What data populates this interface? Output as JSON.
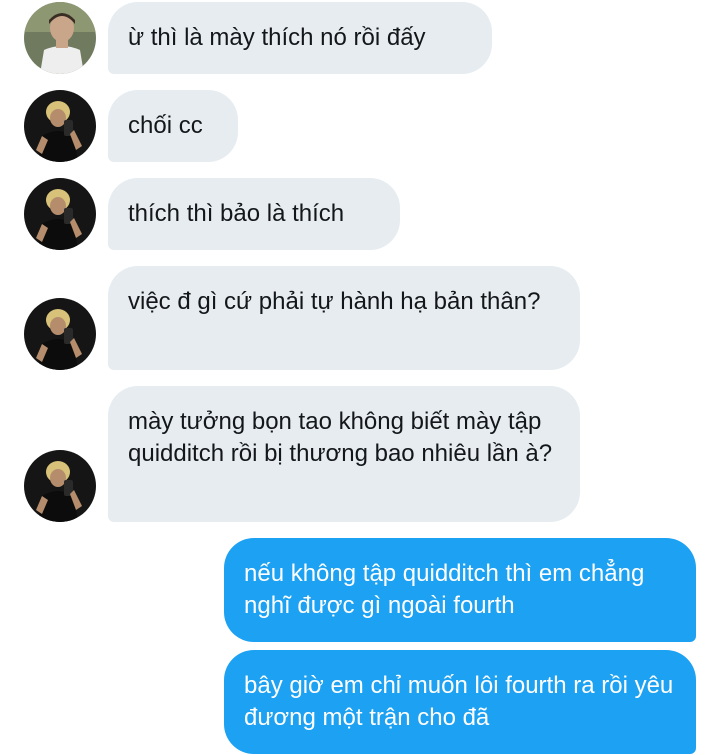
{
  "conversation": {
    "messages": [
      {
        "sender": "other_a",
        "text": "ừ thì là mày thích nó rồi đấy"
      },
      {
        "sender": "other_b",
        "text": "chối cc"
      },
      {
        "sender": "other_b",
        "text": "thích thì bảo là thích"
      },
      {
        "sender": "other_b",
        "text": "việc đ gì cứ phải tự hành hạ bản thân?"
      },
      {
        "sender": "other_b",
        "text": "mày tưởng bọn tao không biết mày tập quidditch rồi bị thương bao nhiêu lần à?"
      },
      {
        "sender": "me",
        "text": "nếu không tập quidditch thì em chẳng nghĩ được gì ngoài fourth"
      },
      {
        "sender": "me",
        "text": "bây giờ em chỉ muốn lôi fourth ra rồi yêu đương một trận cho đã"
      }
    ]
  },
  "colors": {
    "incoming_bubble": "#e6ecf0",
    "incoming_text": "#14171a",
    "outgoing_bubble": "#1da1f2",
    "outgoing_text": "#ffffff"
  },
  "icons": {
    "avatar_a": "avatar-photo",
    "avatar_b": "avatar-photo"
  }
}
